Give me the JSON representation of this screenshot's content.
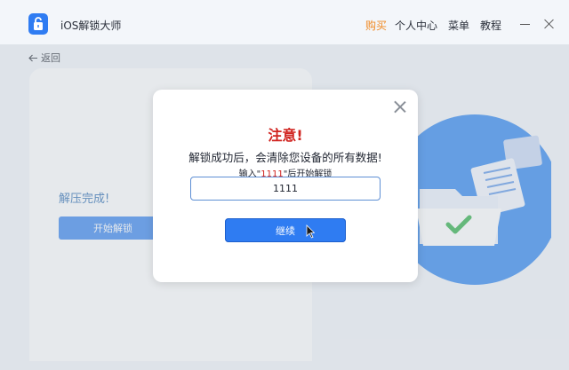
{
  "app": {
    "title": "iOS解锁大师",
    "nav": {
      "buy": "购买",
      "user_center": "个人中心",
      "menu": "菜单",
      "tutorial": "教程"
    }
  },
  "back_label": "返回",
  "panel": {
    "status": "解压完成!",
    "start_button": "开始解锁"
  },
  "dialog": {
    "title": "注意!",
    "warning": "解锁成功后，会清除您设备的所有数据!",
    "hint_prefix": "输入\"",
    "hint_code": "1111",
    "hint_suffix": "\"后开始解锁",
    "input_value": "1111",
    "confirm_button": "继续"
  },
  "colors": {
    "accent": "#2f7cf2",
    "warning": "#d0231f",
    "buy": "#f08a24"
  }
}
